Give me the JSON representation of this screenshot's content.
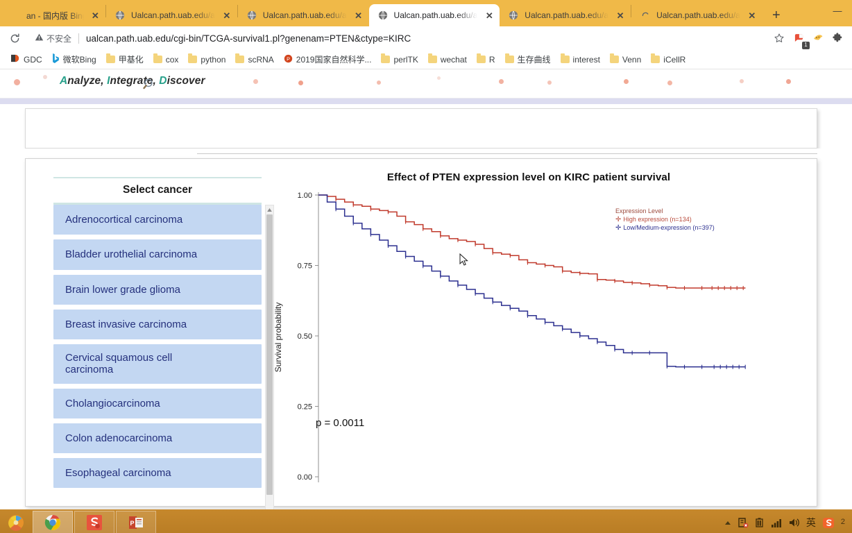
{
  "browser": {
    "tabs": [
      {
        "title": "an - 国内版 Bing",
        "favicon": "none",
        "active": false
      },
      {
        "title": "Ualcan.path.uab.edu/a",
        "favicon": "globe-icon",
        "active": false
      },
      {
        "title": "Ualcan.path.uab.edu/a",
        "favicon": "globe-icon",
        "active": false
      },
      {
        "title": "Ualcan.path.uab.edu/a",
        "favicon": "globe-icon",
        "active": true
      },
      {
        "title": "Ualcan.path.uab.edu/a",
        "favicon": "globe-icon",
        "active": false
      },
      {
        "title": "Ualcan.path.uab.edu/a",
        "favicon": "loading-icon",
        "active": false
      }
    ],
    "new_tab_label": "+",
    "window_controls": {
      "minimize": "—",
      "maximize": "□",
      "close": "✕"
    },
    "toolbar": {
      "reload_icon": "reload-icon",
      "security_label": "不安全",
      "url": "ualcan.path.uab.edu/cgi-bin/TCGA-survival1.pl?genenam=PTEN&ctype=KIRC",
      "star_icon": "bookmark-star-icon",
      "extension_badge": "1",
      "puzzle_icon": "extensions-puzzle-icon"
    },
    "bookmarks": [
      {
        "label": "GDC",
        "icon": "gdc-icon"
      },
      {
        "label": "微软Bing",
        "icon": "bing-icon"
      },
      {
        "label": "甲基化",
        "icon": "folder-icon"
      },
      {
        "label": "cox",
        "icon": "folder-icon"
      },
      {
        "label": "python",
        "icon": "folder-icon"
      },
      {
        "label": "scRNA",
        "icon": "folder-icon"
      },
      {
        "label": "2019国家自然科学...",
        "icon": "powerpoint-icon"
      },
      {
        "label": "perlTK",
        "icon": "folder-icon"
      },
      {
        "label": "wechat",
        "icon": "folder-icon"
      },
      {
        "label": "R",
        "icon": "folder-icon"
      },
      {
        "label": "生存曲线",
        "icon": "folder-icon"
      },
      {
        "label": "interest",
        "icon": "folder-icon"
      },
      {
        "label": "Venn",
        "icon": "folder-icon"
      },
      {
        "label": "iCellR",
        "icon": "folder-icon"
      }
    ]
  },
  "site": {
    "tagline_parts": [
      "A",
      "nalyze, ",
      "I",
      "ntegrate, ",
      "D",
      "iscover"
    ],
    "tagline": "Analyze, Integrate, Discover",
    "magnifier_icon": "magnifier-icon"
  },
  "sidebar": {
    "header": "Select cancer",
    "items": [
      {
        "label": "Adrenocortical carcinoma",
        "lines": 1
      },
      {
        "label": "Bladder urothelial carcinoma",
        "lines": 1
      },
      {
        "label": "Brain lower grade glioma",
        "lines": 1
      },
      {
        "label": "Breast invasive carcinoma",
        "lines": 1
      },
      {
        "label": "Cervical squamous cell carcinoma",
        "lines": 2
      },
      {
        "label": "Cholangiocarcinoma",
        "lines": 1
      },
      {
        "label": "Colon adenocarcinoma",
        "lines": 1
      },
      {
        "label": "Esophageal carcinoma",
        "lines": 1
      }
    ],
    "scrollbar": {
      "up_arrow_icon": "chevron-up-icon"
    }
  },
  "chart_data": {
    "type": "line",
    "title": "Effect of PTEN expression level on KIRC patient survival",
    "xlabel": "",
    "ylabel": "Survival probability",
    "ylim": [
      0.0,
      1.0
    ],
    "yticks": [
      "0.00",
      "0.25",
      "0.50",
      "0.75",
      "1.00"
    ],
    "ytick_values": [
      0.0,
      0.25,
      0.5,
      0.75,
      1.0
    ],
    "xlim": [
      0,
      100
    ],
    "grid": false,
    "legend_position": "right",
    "legend_title": "Expression Level",
    "annotation": "p = 0.0011",
    "p_value": 0.0011,
    "series": [
      {
        "name": "High expression (n=134)",
        "n": 134,
        "color": "#c0392b",
        "marker": "censor-tick",
        "x": [
          0,
          2,
          4,
          6,
          8,
          10,
          12,
          14,
          16,
          18,
          20,
          22,
          24,
          26,
          28,
          30,
          32,
          34,
          36,
          38,
          40,
          42,
          44,
          46,
          48,
          50,
          52,
          54,
          56,
          58,
          60,
          62,
          64,
          66,
          68,
          70,
          72,
          74,
          76,
          78,
          80,
          82,
          84,
          86,
          88,
          90
        ],
        "y": [
          1.0,
          0.995,
          0.985,
          0.975,
          0.965,
          0.96,
          0.95,
          0.945,
          0.94,
          0.925,
          0.905,
          0.895,
          0.88,
          0.87,
          0.855,
          0.845,
          0.84,
          0.835,
          0.825,
          0.81,
          0.795,
          0.79,
          0.785,
          0.77,
          0.76,
          0.755,
          0.75,
          0.745,
          0.73,
          0.725,
          0.722,
          0.72,
          0.7,
          0.698,
          0.695,
          0.69,
          0.688,
          0.685,
          0.68,
          0.678,
          0.672,
          0.67,
          0.67,
          0.67,
          0.67,
          0.67
        ]
      },
      {
        "name": "Low/Medium-expression (n=397)",
        "n": 397,
        "color": "#2b2f8f",
        "marker": "censor-tick",
        "x": [
          0,
          2,
          4,
          6,
          8,
          10,
          12,
          14,
          16,
          18,
          20,
          22,
          24,
          26,
          28,
          30,
          32,
          34,
          36,
          38,
          40,
          42,
          44,
          46,
          48,
          50,
          52,
          54,
          56,
          58,
          60,
          62,
          64,
          66,
          68,
          70,
          72,
          74,
          76,
          78,
          80,
          82,
          84,
          86,
          88,
          90
        ],
        "y": [
          1.0,
          0.975,
          0.95,
          0.925,
          0.9,
          0.88,
          0.86,
          0.84,
          0.82,
          0.8,
          0.782,
          0.765,
          0.748,
          0.73,
          0.712,
          0.695,
          0.68,
          0.665,
          0.65,
          0.634,
          0.62,
          0.608,
          0.598,
          0.588,
          0.572,
          0.56,
          0.548,
          0.536,
          0.524,
          0.512,
          0.5,
          0.49,
          0.478,
          0.466,
          0.452,
          0.44,
          0.44,
          0.44,
          0.44,
          0.44,
          0.392,
          0.39,
          0.39,
          0.39,
          0.39,
          0.39
        ]
      }
    ]
  },
  "cursor": {
    "icon": "mouse-pointer-icon"
  },
  "taskbar": {
    "start_icon": "windows-start-icon",
    "apps": [
      {
        "name": "chrome-icon",
        "active": true
      },
      {
        "name": "snagit-icon",
        "active": false
      },
      {
        "name": "powerpoint-icon",
        "active": false
      }
    ],
    "tray": [
      {
        "icon": "chevron-up-icon"
      },
      {
        "icon": "network-error-icon"
      },
      {
        "icon": "battery-icon"
      },
      {
        "icon": "signal-bars-icon"
      },
      {
        "icon": "volume-icon"
      },
      {
        "icon": "ime-chinese-icon",
        "label": "英"
      },
      {
        "icon": "sogou-icon"
      }
    ]
  }
}
